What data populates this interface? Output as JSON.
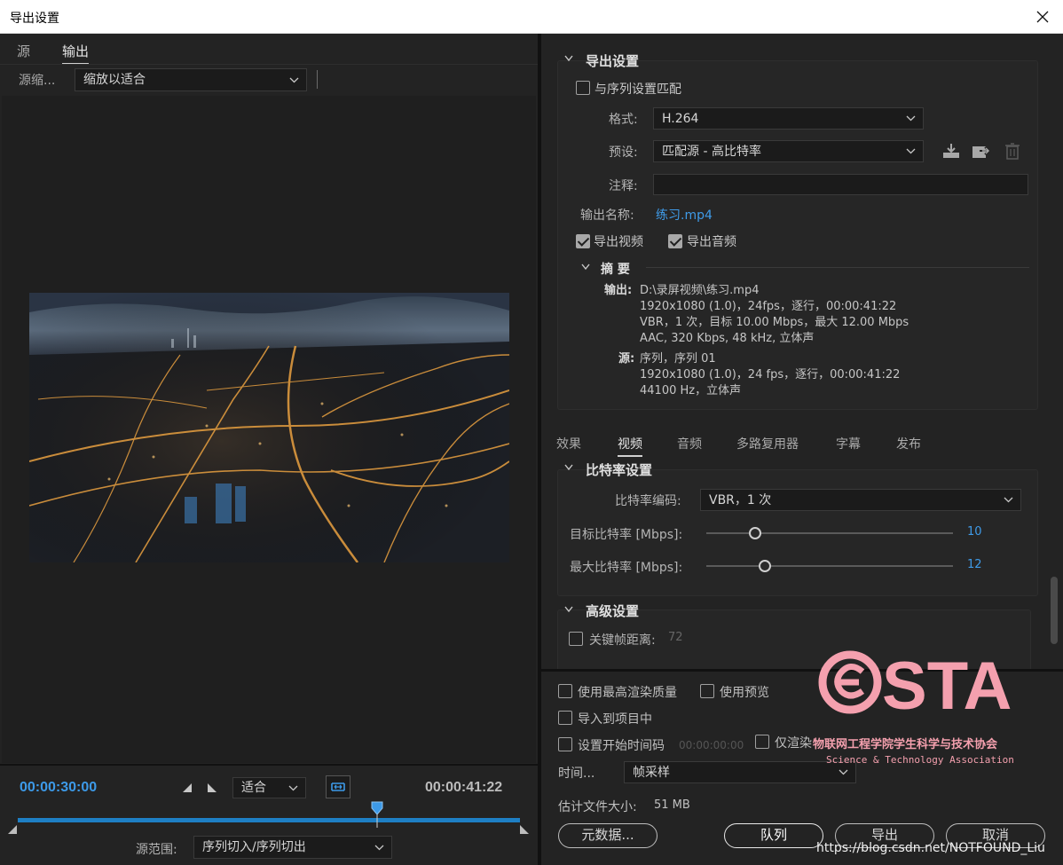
{
  "window": {
    "title": "导出设置"
  },
  "left": {
    "tabs": [
      "源",
      "输出"
    ],
    "source_scale_label": "源缩...",
    "scale_select": "缩放以适合",
    "timecode_current": "00:00:30:00",
    "timecode_total": "00:00:41:22",
    "fit_select": "适合",
    "source_range_label": "源范围:",
    "source_range_select": "序列切入/序列切出"
  },
  "export_settings": {
    "header": "导出设置",
    "match_sequence": "与序列设置匹配",
    "format_label": "格式:",
    "format_value": "H.264",
    "preset_label": "预设:",
    "preset_value": "匹配源 - 高比特率",
    "comments_label": "注释:",
    "output_name_label": "输出名称:",
    "output_name_value": "练习.mp4",
    "export_video": "导出视频",
    "export_audio": "导出音频",
    "summary_header": "摘 要",
    "output_label": "输出:",
    "output_lines": [
      "D:\\录屏视频\\练习.mp4",
      "1920x1080 (1.0)，24fps，逐行，00:00:41:22",
      "VBR，1 次，目标 10.00 Mbps，最大 12.00 Mbps",
      "AAC, 320 Kbps, 48  kHz, 立体声"
    ],
    "source_label": "源:",
    "source_lines": [
      "序列，序列 01",
      "1920x1080 (1.0)，24 fps，逐行，00:00:41:22",
      "44100 Hz，立体声"
    ]
  },
  "tabs": [
    "效果",
    "视频",
    "音频",
    "多路复用器",
    "字幕",
    "发布"
  ],
  "active_tab": "视频",
  "bitrate": {
    "header": "比特率设置",
    "encoding_label": "比特率编码:",
    "encoding_value": "VBR，1 次",
    "target_label": "目标比特率 [Mbps]:",
    "target_value": "10",
    "max_label": "最大比特率 [Mbps]:",
    "max_value": "12"
  },
  "advanced": {
    "header": "高级设置",
    "keyframe_label": "关键帧距离:",
    "keyframe_value": "72"
  },
  "bottom": {
    "max_render_quality": "使用最高渲染质量",
    "use_previews": "使用预览",
    "import_into_project": "导入到项目中",
    "set_start_timecode": "设置开始时间码",
    "start_timecode_value": "00:00:00:00",
    "render_alpha_only": "仅渲染",
    "time_interp_label": "时间...",
    "time_interp_value": "帧采样",
    "est_size_label": "估计文件大小:",
    "est_size_value": "51 MB",
    "metadata_button": "元数据...",
    "queue_button": "队列",
    "export_button": "导出",
    "cancel_button": "取消"
  },
  "watermark": {
    "logo_text": "STA",
    "line1": "物联网工程学院学生科学与技术协会",
    "line2": "Science & Technology Association",
    "url": "https://blog.csdn.net/NOTFOUND_Liu"
  },
  "colors": {
    "accent_blue": "#3f9be8",
    "timeline_blue": "#1e7fc4",
    "watermark_pink": "#f4a0ae"
  }
}
